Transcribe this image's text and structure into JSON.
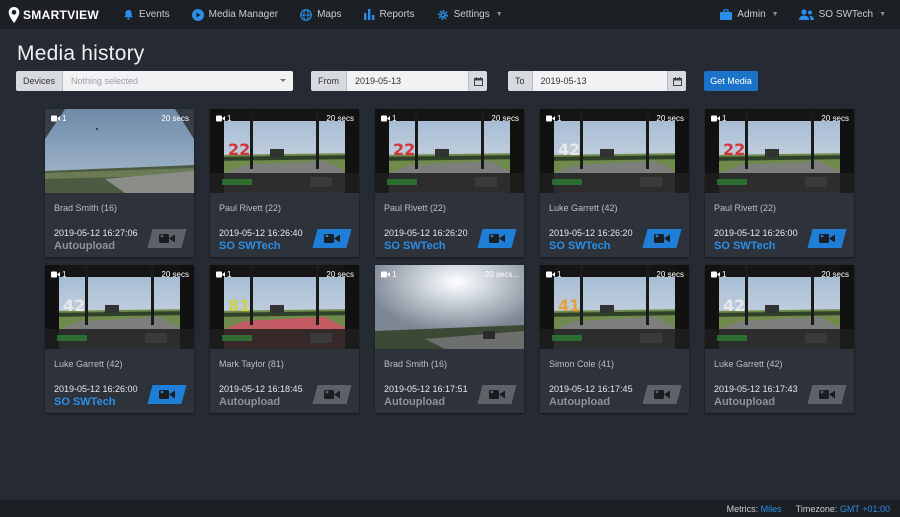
{
  "app": {
    "logo_text": "SMARTVIEW"
  },
  "nav": {
    "items": [
      {
        "label": "Events",
        "icon": "bell-icon"
      },
      {
        "label": "Media Manager",
        "icon": "play-circle-icon"
      },
      {
        "label": "Maps",
        "icon": "globe-icon"
      },
      {
        "label": "Reports",
        "icon": "bar-chart-icon"
      },
      {
        "label": "Settings",
        "icon": "gear-icon"
      }
    ],
    "admin_label": "Admin",
    "user_label": "SO SWTech"
  },
  "page": {
    "title": "Media history"
  },
  "filters": {
    "devices_label": "Devices",
    "devices_placeholder": "Nothing selected",
    "from_label": "From",
    "from_value": "2019-05-13",
    "to_label": "To",
    "to_value": "2019-05-13",
    "get_media_label": "Get Media"
  },
  "cards": [
    {
      "camera": "1",
      "duration": "20 secs",
      "driver": "Brad Smith (16)",
      "timestamp": "2019-05-12 16:27:06",
      "source": "Autoupload",
      "kind": "auto",
      "scene": "sky"
    },
    {
      "camera": "1",
      "duration": "20 secs",
      "driver": "Paul Rivett (22)",
      "timestamp": "2019-05-12 16:26:40",
      "source": "SO SWTech",
      "kind": "user",
      "scene": "cab22"
    },
    {
      "camera": "1",
      "duration": "20 secs",
      "driver": "Paul Rivett (22)",
      "timestamp": "2019-05-12 16:26:20",
      "source": "SO SWTech",
      "kind": "user",
      "scene": "cab22"
    },
    {
      "camera": "1",
      "duration": "20 secs",
      "driver": "Luke Garrett (42)",
      "timestamp": "2019-05-12 16:26:20",
      "source": "SO SWTech",
      "kind": "user",
      "scene": "cab42"
    },
    {
      "camera": "1",
      "duration": "20 secs",
      "driver": "Paul Rivett (22)",
      "timestamp": "2019-05-12 16:26:00",
      "source": "SO SWTech",
      "kind": "user",
      "scene": "cab22"
    },
    {
      "camera": "1",
      "duration": "20 secs",
      "driver": "Luke Garrett (42)",
      "timestamp": "2019-05-12 16:26:00",
      "source": "SO SWTech",
      "kind": "user",
      "scene": "cab42"
    },
    {
      "camera": "1",
      "duration": "20 secs",
      "driver": "Mark Taylor (81)",
      "timestamp": "2019-05-12 16:18:45",
      "source": "Autoupload",
      "kind": "auto",
      "scene": "cab81"
    },
    {
      "camera": "1",
      "duration": "20 secs...",
      "driver": "Brad Smith (16)",
      "timestamp": "2019-05-12 16:17:51",
      "source": "Autoupload",
      "kind": "auto",
      "scene": "sun"
    },
    {
      "camera": "1",
      "duration": "20 secs",
      "driver": "Simon Cole (41)",
      "timestamp": "2019-05-12 16:17:45",
      "source": "Autoupload",
      "kind": "auto",
      "scene": "cab41"
    },
    {
      "camera": "1",
      "duration": "20 secs",
      "driver": "Luke Garrett (42)",
      "timestamp": "2019-05-12 16:17:43",
      "source": "Autoupload",
      "kind": "auto",
      "scene": "cab42"
    }
  ],
  "footer": {
    "metrics_label": "Metrics:",
    "metrics_value": "Miles",
    "timezone_label": "Timezone:",
    "timezone_value": "GMT +01:00"
  },
  "colors": {
    "accent": "#1a73c8",
    "user_source": "#2a8fe8",
    "auto_source": "#8c929a"
  }
}
